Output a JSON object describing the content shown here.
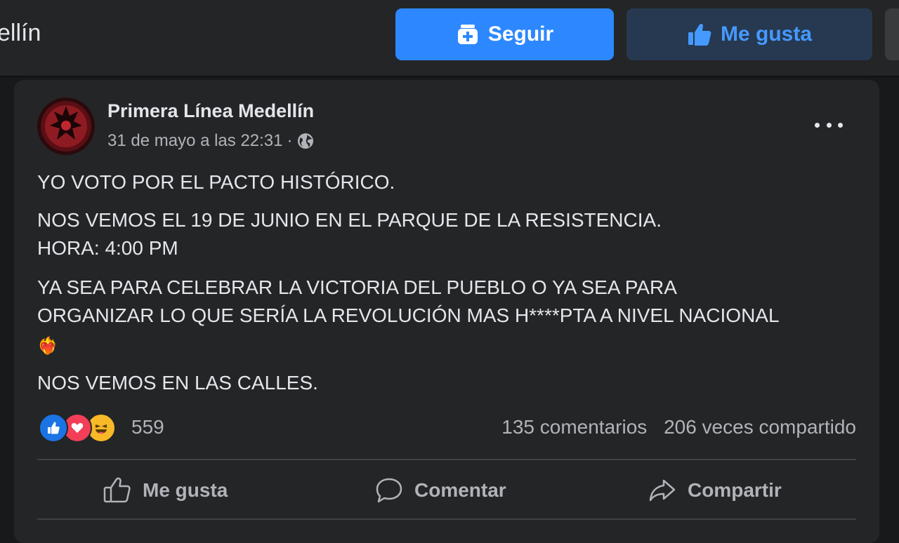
{
  "header": {
    "page_name": "ellín",
    "follow_label": "Seguir",
    "like_label": "Me gusta"
  },
  "post": {
    "author": "Primera Línea Medellín",
    "timestamp": "31 de mayo a las 22:31",
    "separator": "·",
    "audience_icon": "globe-icon",
    "lines": {
      "l1": "YO VOTO POR EL PACTO HISTÓRICO.",
      "l2": "NOS VEMOS EL 19 DE JUNIO EN EL PARQUE DE LA RESISTENCIA.",
      "l3": "HORA: 4:00 PM",
      "l4": "YA SEA PARA CELEBRAR LA VICTORIA DEL PUEBLO O YA SEA PARA",
      "l5": "ORGANIZAR LO QUE SERÍA LA REVOLUCIÓN MAS H****PTA A NIVEL NACIONAL",
      "l6": "❤️‍🔥",
      "l7": "NOS VEMOS EN LAS CALLES."
    },
    "reactions": {
      "icons": [
        "like-reaction-icon",
        "love-reaction-icon",
        "haha-reaction-icon"
      ],
      "count": "559"
    },
    "comments": "135 comentarios",
    "shares": "206 veces compartido",
    "actions": {
      "like": "Me gusta",
      "comment": "Comentar",
      "share": "Compartir"
    }
  },
  "colors": {
    "background": "#18191a",
    "card": "#242526",
    "primary_blue": "#2d88ff",
    "like_button_bg": "#263951",
    "text_primary": "#e4e6eb",
    "text_secondary": "#b0b3b8"
  }
}
